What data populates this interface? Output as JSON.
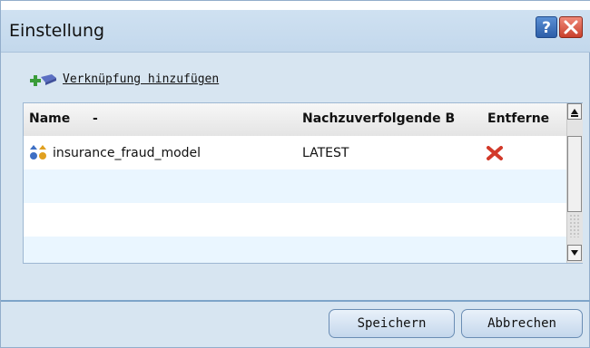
{
  "dialog": {
    "title": "Einstellung",
    "help_label": "?"
  },
  "toolbar": {
    "add_link_label": "Verknüpfung hinzufügen"
  },
  "table": {
    "columns": [
      "Name",
      "-",
      "Nachzuverfolgende B",
      "Entferne"
    ],
    "rows": [
      {
        "name": "insurance_fraud_model",
        "tracked": "LATEST",
        "remove": "remove-icon"
      },
      {
        "name": "",
        "tracked": "",
        "remove": ""
      },
      {
        "name": "",
        "tracked": "",
        "remove": ""
      },
      {
        "name": "",
        "tracked": "",
        "remove": ""
      }
    ]
  },
  "buttons": {
    "save_label": "Speichern",
    "cancel_label": "Abbrechen"
  },
  "colors": {
    "row_alt": "#eaf6ff",
    "dialog_bg": "#d7e5f1",
    "close_red": "#c9402c",
    "help_blue": "#2d5ea8"
  }
}
